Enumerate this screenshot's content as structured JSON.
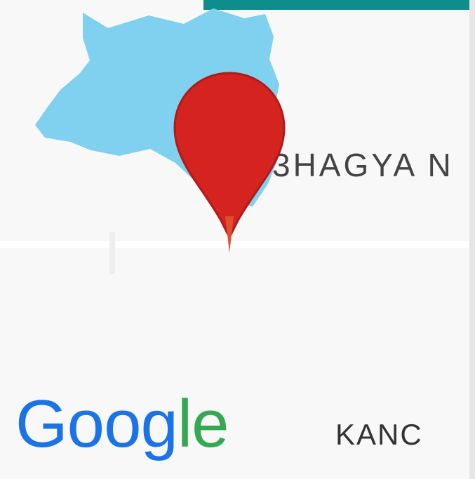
{
  "map": {
    "colors": {
      "water": "#7fd1ef",
      "pin": "#d52320",
      "pin_dark": "#b01b18",
      "label": "#444444",
      "logo_blue": "#1a73e8",
      "logo_green": "#34a853"
    },
    "labels": {
      "area_top": "3HAGYA N",
      "area_bottom": "KANC"
    },
    "logo": {
      "letters": [
        "G",
        "o",
        "o",
        "g",
        "l",
        "e"
      ]
    },
    "marker": {
      "icon": "map-pin-icon"
    }
  }
}
